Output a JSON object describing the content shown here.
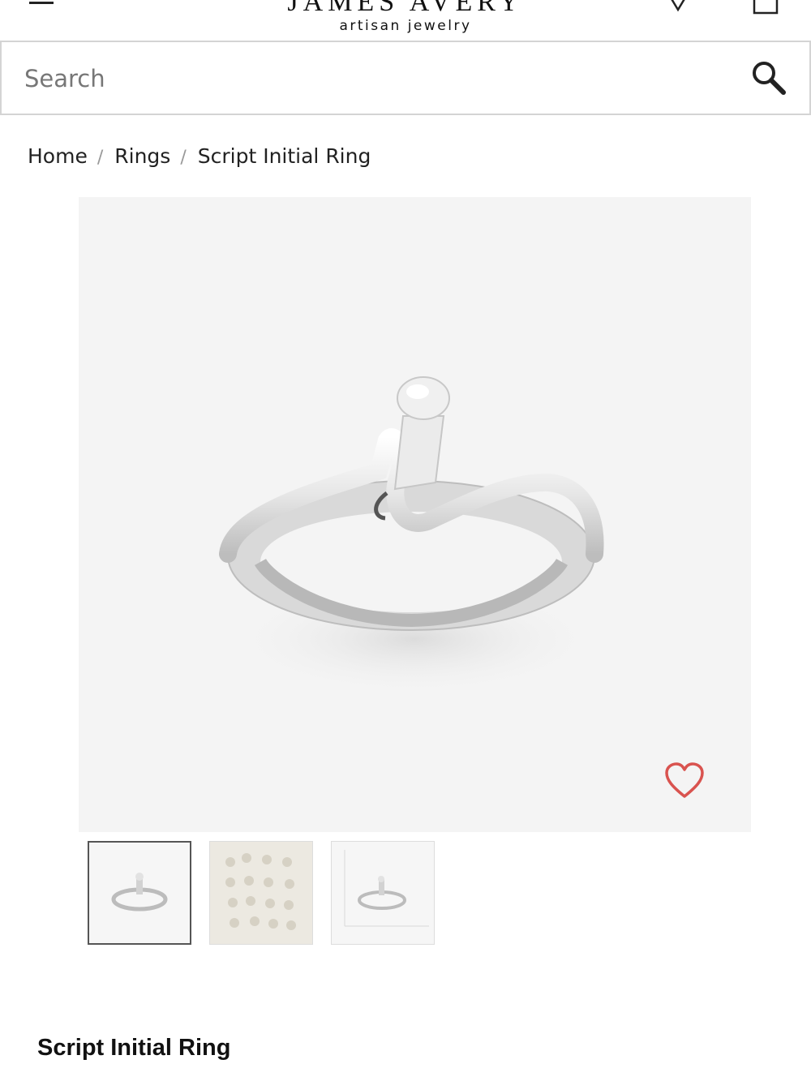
{
  "header": {
    "logo_top": "JAMES AVERY",
    "logo_sub": "artisan jewelry",
    "icons": [
      "menu-icon",
      "location-pin-icon",
      "shopping-bag-icon"
    ]
  },
  "search": {
    "placeholder": "Search",
    "icon": "search-icon"
  },
  "breadcrumb": {
    "items": [
      "Home",
      "Rings",
      "Script Initial Ring"
    ],
    "separator": "/"
  },
  "product_image": {
    "wishlist_icon": "heart-icon",
    "wishlist_color": "#d9534f"
  },
  "thumbnails": {
    "count": 3,
    "selected_index": 0
  },
  "product": {
    "title": "Script Initial Ring"
  }
}
